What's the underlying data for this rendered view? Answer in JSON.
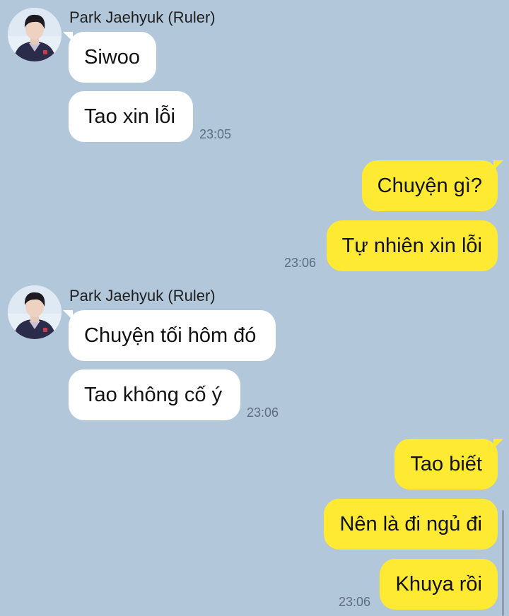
{
  "messages": {
    "group1": {
      "sender": "Park Jaehyuk (Ruler)",
      "bubbles": [
        "Siwoo",
        "Tao xin lỗi"
      ],
      "time": "23:05"
    },
    "group2": {
      "bubbles": [
        "Chuyện gì?",
        "Tự nhiên xin lỗi"
      ],
      "time": "23:06"
    },
    "group3": {
      "sender": "Park Jaehyuk (Ruler)",
      "bubbles": [
        "Chuyện tối hôm đó",
        "Tao không cố ý"
      ],
      "time": "23:06"
    },
    "group4": {
      "bubbles": [
        "Tao biết",
        "Nên là đi ngủ đi",
        "Khuya rồi"
      ],
      "time": "23:06"
    }
  },
  "colors": {
    "background": "#b2c7da",
    "incoming_bubble": "#ffffff",
    "outgoing_bubble": "#fee933",
    "timestamp": "#5d6e7f"
  }
}
